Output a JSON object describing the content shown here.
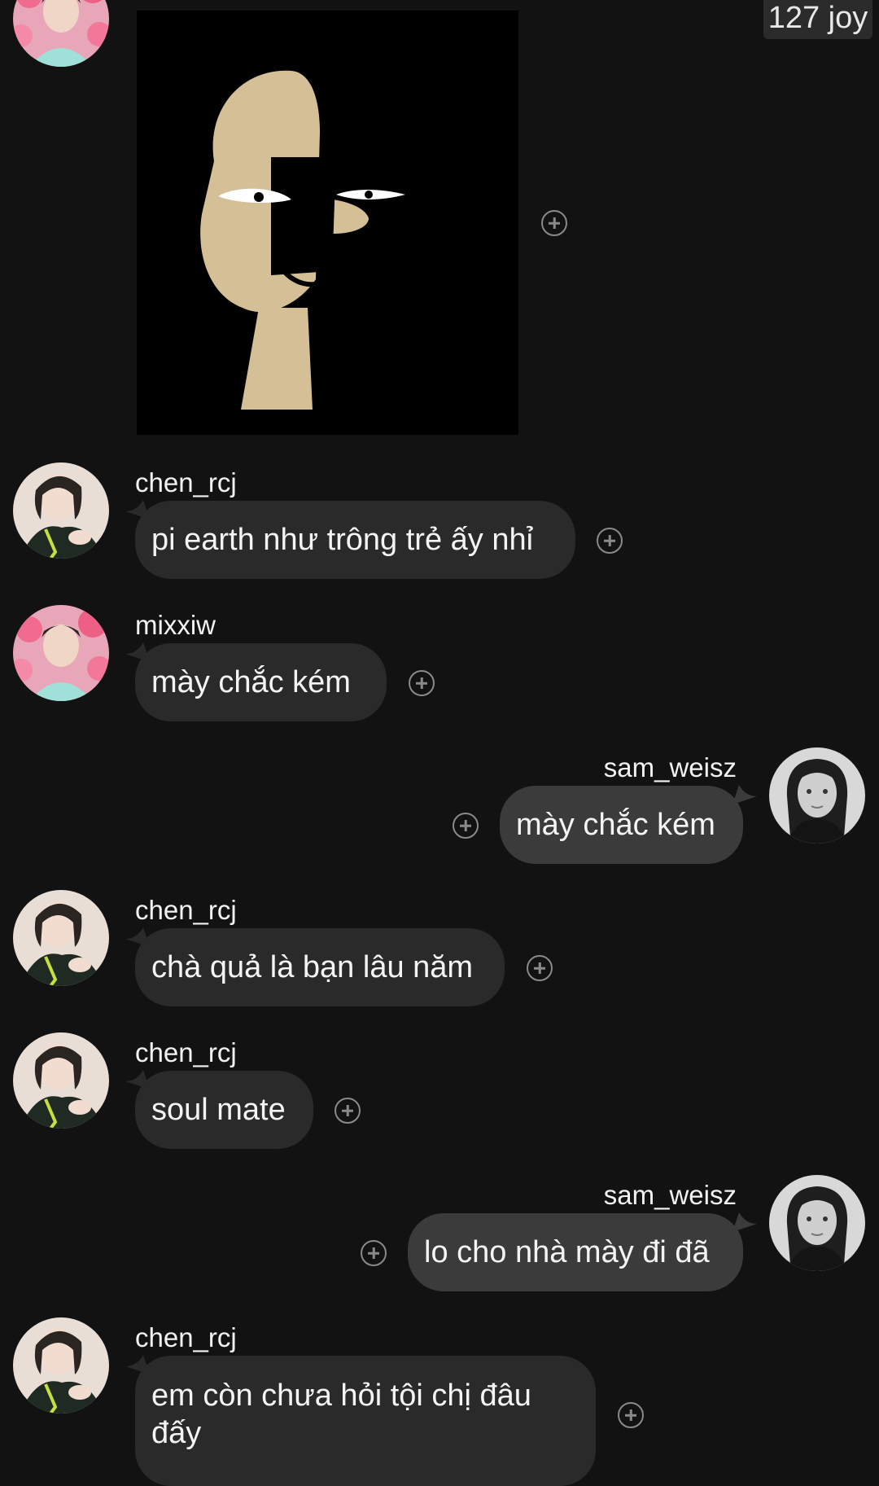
{
  "header": {
    "counter_text": "127 joy"
  },
  "colors": {
    "background": "#121212",
    "bubble_incoming": "#2a2a2a",
    "bubble_outgoing": "#3b3b3b",
    "sticker_fill": "#d4bf97"
  },
  "icons": {
    "react": "add-reaction-icon"
  },
  "messages": [
    {
      "sender": "mixxiw",
      "type": "sticker",
      "sticker": "tan-dog-side-eye-sticker"
    },
    {
      "sender": "chen_rcj",
      "type": "text",
      "text": "pi earth như trông trẻ ấy nhỉ"
    },
    {
      "sender": "mixxiw",
      "type": "text",
      "text": "mày chắc kém"
    },
    {
      "sender": "sam_weisz",
      "type": "text",
      "text": "mày chắc kém",
      "outgoing": true
    },
    {
      "sender": "chen_rcj",
      "type": "text",
      "text": "chà quả là bạn lâu năm"
    },
    {
      "sender": "chen_rcj",
      "type": "text",
      "text": "soul mate"
    },
    {
      "sender": "sam_weisz",
      "type": "text",
      "text": "lo cho nhà mày đi đã",
      "outgoing": true
    },
    {
      "sender": "chen_rcj",
      "type": "text",
      "text": "em còn chưa hỏi tội chị đâu đấy"
    }
  ]
}
